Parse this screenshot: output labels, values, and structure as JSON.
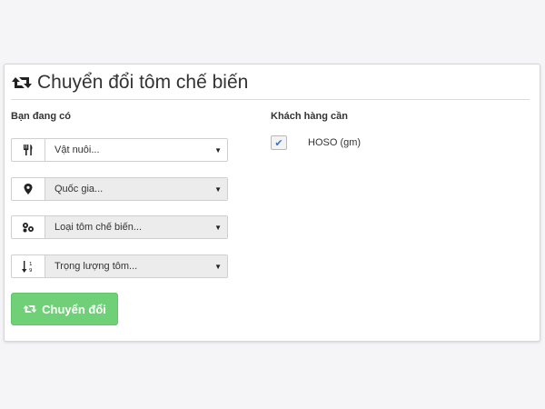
{
  "page": {
    "title": "Chuyển đổi tôm chế biến",
    "title_icon": "retweet-icon"
  },
  "left": {
    "heading": "Bạn đang có",
    "fields": [
      {
        "icon": "cutlery-icon",
        "value": "Vật nuôi..."
      },
      {
        "icon": "map-marker-icon",
        "value": "Quốc gia..."
      },
      {
        "icon": "shrimp-processing-icon",
        "value": "Loại tôm chế biến..."
      },
      {
        "icon": "sort-numeric-icon",
        "value": "Trọng lượng tôm..."
      }
    ],
    "convert_label": "Chuyển đổi",
    "convert_icon": "retweet-icon"
  },
  "right": {
    "heading": "Khách hàng cần",
    "checkbox_label": "HOSO (gm)",
    "checkbox_checked": true
  },
  "colors": {
    "accent_green": "#6fd078",
    "check_blue": "#3a75c4",
    "page_bg": "#f5f5f7"
  }
}
